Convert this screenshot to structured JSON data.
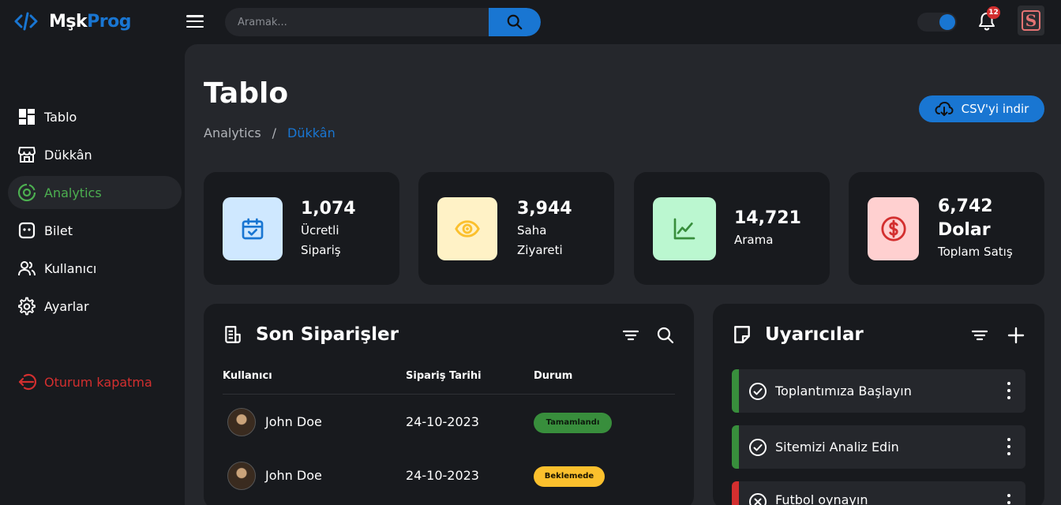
{
  "brand": {
    "part1": "Mşk",
    "part2": "Prog",
    "accent": "#1976d2"
  },
  "search": {
    "placeholder": "Aramak..."
  },
  "notifications": {
    "count": "12"
  },
  "profile": {
    "letter": "S"
  },
  "sidebar": {
    "items": [
      {
        "label": "Tablo",
        "icon": "dashboard-icon"
      },
      {
        "label": "Dükkân",
        "icon": "store-icon"
      },
      {
        "label": "Analytics",
        "icon": "analytics-icon",
        "active": true
      },
      {
        "label": "Bilet",
        "icon": "ticket-icon"
      },
      {
        "label": "Kullanıcı",
        "icon": "users-icon"
      },
      {
        "label": "Ayarlar",
        "icon": "settings-icon"
      }
    ],
    "logout": "Oturum kapatma"
  },
  "header": {
    "title": "Tablo",
    "breadcrumb": [
      "Analytics",
      "/",
      "Dükkân"
    ],
    "csv_button": "CSV'yi indir"
  },
  "stats": [
    {
      "value": "1,074",
      "label1": "Ücretli",
      "label2": "Sipariş",
      "icon": "calendar-check-icon",
      "bg": "#cfe8ff",
      "color": "#1976d2"
    },
    {
      "value": "3,944",
      "label1": "Saha",
      "label2": "Ziyareti",
      "icon": "eye-icon",
      "bg": "#fff2c6",
      "color": "#fbc02d"
    },
    {
      "value": "14,721",
      "label1": "Arama",
      "label2": "",
      "icon": "line-chart-icon",
      "bg": "#bbf7d0",
      "color": "#388e3c"
    },
    {
      "value": "6,742",
      "value2": "Dolar",
      "label1": "Toplam Satış",
      "label2": "",
      "icon": "dollar-circle-icon",
      "bg": "#ffd0d0",
      "color": "#d32f2f"
    }
  ],
  "orders": {
    "title": "Son Siparişler",
    "columns": [
      "Kullanıcı",
      "Sipariş Tarihi",
      "Durum"
    ],
    "rows": [
      {
        "user": "John Doe",
        "date": "24-10-2023",
        "status": "Tamamlandı"
      },
      {
        "user": "John Doe",
        "date": "24-10-2023",
        "status": "Beklemede"
      }
    ]
  },
  "alerts": {
    "title": "Uyarıcılar",
    "items": [
      {
        "text": "Toplantımıza Başlayın"
      },
      {
        "text": "Sitemizi Analiz Edin"
      },
      {
        "text": "Futbol oynayın"
      }
    ]
  }
}
